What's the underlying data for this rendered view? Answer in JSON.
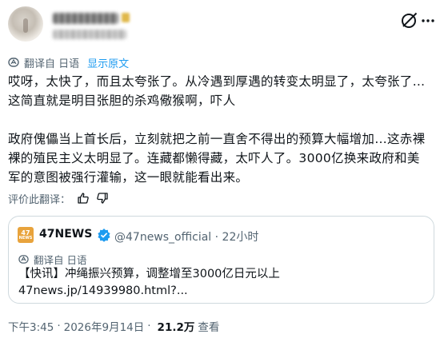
{
  "header": {
    "grok_icon": "grok-icon",
    "more_icon": "more-icon"
  },
  "translation": {
    "label": "翻译自 日语",
    "show_original": "显示原文"
  },
  "post": {
    "text": "哎呀，太快了，而且太夸张了。从冷遇到厚遇的转变太明显了，太夸张了…\n这简直就是明目张胆的杀鸡儆猴啊，吓人\n\n政府傀儡当上首长后，立刻就把之前一直舍不得出的预算大幅增加…这赤裸\n裸的殖民主义太明显了。连藏都懒得藏，太吓人了。3000亿换来政府和美\n军的意图被强行灌输，这一眼就能看出来。"
  },
  "rating": {
    "label": "评价此翻译："
  },
  "quote": {
    "logo_text": "47",
    "logo_sub": "NEWS",
    "name": "47NEWS",
    "handle_time": "@47news_official · 22小时",
    "translate_label": "翻译自 日语",
    "text_line1": "【快讯】冲绳振兴预算，调整增至3000亿日元以上",
    "text_line2": "47news.jp/14939980.html?..."
  },
  "meta": {
    "time": "下午3:45",
    "date": "2026年9月14日",
    "views_count": "21.2万",
    "views_label": "查看"
  },
  "colors": {
    "accent": "#1d9bf0",
    "muted": "#536471",
    "logo": "#e8a33c"
  }
}
